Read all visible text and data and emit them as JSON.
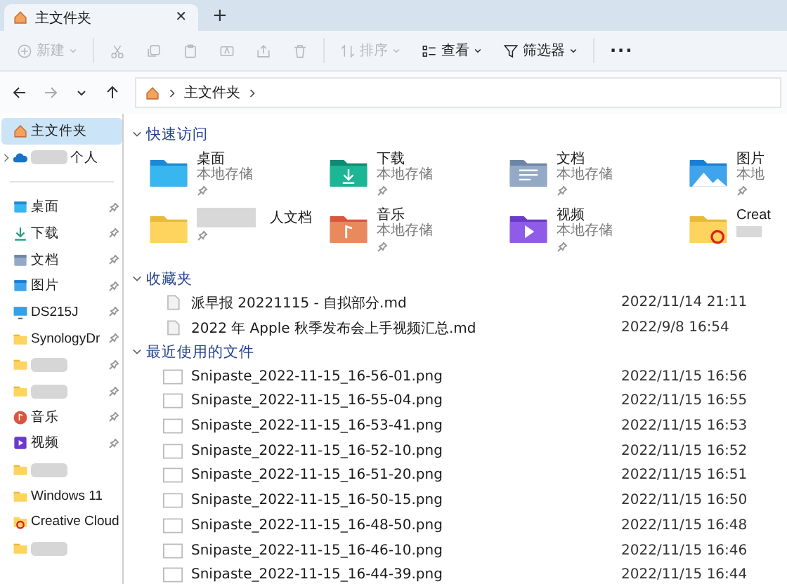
{
  "tabs": [
    {
      "label": "主文件夹",
      "selected": true,
      "close": "✕"
    }
  ],
  "new_tab": "+",
  "toolbar": [
    {
      "kind": "new",
      "label": "新建",
      "disabled": true,
      "dropdown": true
    },
    {
      "kind": "cut",
      "disabled": true
    },
    {
      "kind": "copy",
      "disabled": true
    },
    {
      "kind": "paste",
      "disabled": true
    },
    {
      "kind": "rename",
      "disabled": true
    },
    {
      "kind": "share",
      "disabled": true
    },
    {
      "kind": "delete",
      "disabled": true
    },
    {
      "kind": "sort",
      "label": "排序",
      "disabled": true,
      "dropdown": true
    },
    {
      "kind": "view",
      "label": "查看",
      "disabled": false,
      "dropdown": true
    },
    {
      "kind": "filter",
      "label": "筛选器",
      "disabled": false,
      "dropdown": true
    },
    {
      "kind": "more",
      "label": "···",
      "disabled": false
    }
  ],
  "address": {
    "nav": [
      {
        "kind": "back",
        "disabled": false
      },
      {
        "kind": "forward",
        "disabled": true
      },
      {
        "kind": "recent",
        "disabled": false
      },
      {
        "kind": "up",
        "disabled": false
      }
    ],
    "crumbs": [
      "主文件夹"
    ]
  },
  "sidebar": {
    "items": [
      {
        "kind": "home",
        "label": "主文件夹",
        "selected": true,
        "pinned": false,
        "redacted": false
      },
      {
        "kind": "cloud",
        "label": "个人",
        "selected": false,
        "pinned": false,
        "redacted": true,
        "expander": true
      },
      {
        "kind": "desktop",
        "label": "桌面",
        "selected": false,
        "pinned": true,
        "redacted": false
      },
      {
        "kind": "download",
        "label": "下载",
        "selected": false,
        "pinned": true,
        "redacted": false
      },
      {
        "kind": "docs",
        "label": "文档",
        "selected": false,
        "pinned": true,
        "redacted": false
      },
      {
        "kind": "pictures",
        "label": "图片",
        "selected": false,
        "pinned": true,
        "redacted": false
      },
      {
        "kind": "nas",
        "label": "DS215J",
        "selected": false,
        "pinned": true,
        "redacted": false
      },
      {
        "kind": "synology",
        "label": "SynologyDr",
        "selected": false,
        "pinned": true,
        "redacted": false
      },
      {
        "kind": "folder",
        "selected": false,
        "pinned": true,
        "redacted": true
      },
      {
        "kind": "folder",
        "selected": false,
        "pinned": true,
        "redacted": true
      },
      {
        "kind": "music",
        "label": "音乐",
        "selected": false,
        "pinned": true,
        "redacted": false
      },
      {
        "kind": "video",
        "label": "视频",
        "selected": false,
        "pinned": true,
        "redacted": false
      },
      {
        "kind": "folder",
        "selected": false,
        "pinned": false,
        "redacted": true
      },
      {
        "kind": "folder",
        "label": "Windows 11",
        "selected": false,
        "pinned": false,
        "redacted": false
      },
      {
        "kind": "cc",
        "label": "Creative Cloud",
        "selected": false,
        "pinned": false,
        "redacted": false
      },
      {
        "kind": "folder",
        "selected": false,
        "pinned": false,
        "redacted": true
      }
    ]
  },
  "quick_access": {
    "title": "快速访问",
    "expanded": true,
    "items": [
      {
        "kind": "desktop",
        "name": "桌面",
        "sub": "本地存储",
        "pinned": true,
        "redacted": false
      },
      {
        "kind": "download",
        "name": "下载",
        "sub": "本地存储",
        "pinned": true,
        "redacted": false
      },
      {
        "kind": "docs",
        "name": "文档",
        "sub": "本地存储",
        "pinned": true,
        "redacted": false
      },
      {
        "kind": "pictures",
        "name": "图片",
        "sub": "本地",
        "pinned": true,
        "redacted": false
      },
      {
        "kind": "folder",
        "name": "人文档",
        "pinned": true,
        "redacted": true
      },
      {
        "kind": "music",
        "name": "音乐",
        "sub": "本地存储",
        "pinned": true,
        "redacted": false
      },
      {
        "kind": "video",
        "name": "视频",
        "sub": "本地存储",
        "pinned": true,
        "redacted": false
      },
      {
        "kind": "cc",
        "name": "Creat",
        "pinned": false,
        "redacted": true
      }
    ]
  },
  "favorites": {
    "title": "收藏夹",
    "expanded": true,
    "rows": [
      {
        "kind": "md",
        "name": "派早报 20221115 - 自拟部分.md",
        "date": "2022/11/14 21:11"
      },
      {
        "kind": "md",
        "name": "2022 年 Apple 秋季发布会上手视频汇总.md",
        "date": "2022/9/8 16:54"
      }
    ]
  },
  "recent": {
    "title": "最近使用的文件",
    "expanded": true,
    "rows": [
      {
        "kind": "png",
        "name": "Snipaste_2022-11-15_16-56-01.png",
        "date": "2022/11/15 16:56"
      },
      {
        "kind": "png",
        "name": "Snipaste_2022-11-15_16-55-04.png",
        "date": "2022/11/15 16:55"
      },
      {
        "kind": "png",
        "name": "Snipaste_2022-11-15_16-53-41.png",
        "date": "2022/11/15 16:53"
      },
      {
        "kind": "png",
        "name": "Snipaste_2022-11-15_16-52-10.png",
        "date": "2022/11/15 16:52"
      },
      {
        "kind": "png",
        "name": "Snipaste_2022-11-15_16-51-20.png",
        "date": "2022/11/15 16:51"
      },
      {
        "kind": "png",
        "name": "Snipaste_2022-11-15_16-50-15.png",
        "date": "2022/11/15 16:50"
      },
      {
        "kind": "png",
        "name": "Snipaste_2022-11-15_16-48-50.png",
        "date": "2022/11/15 16:48"
      },
      {
        "kind": "png",
        "name": "Snipaste_2022-11-15_16-46-10.png",
        "date": "2022/11/15 16:46"
      },
      {
        "kind": "png",
        "name": "Snipaste_2022-11-15_16-44-39.png",
        "date": "2022/11/15 16:44"
      }
    ]
  }
}
